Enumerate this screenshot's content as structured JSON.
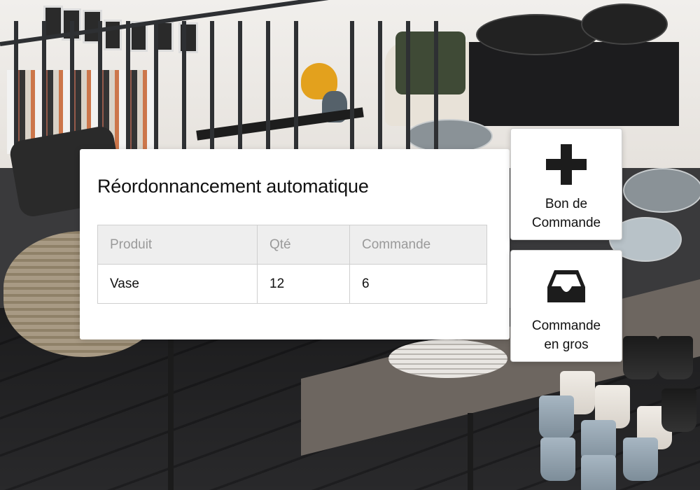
{
  "card": {
    "title": "Réordonnancement automatique",
    "table": {
      "headers": [
        "Produit",
        "Qté",
        "Commande"
      ],
      "rows": [
        [
          "Vase",
          "12",
          "6"
        ]
      ]
    }
  },
  "actions": [
    {
      "id": "purchase-order",
      "icon": "plus-icon",
      "label_lines": [
        "Bon de",
        "Commande"
      ]
    },
    {
      "id": "bulk-order",
      "icon": "inbox-tray-icon",
      "label_lines": [
        "Commande",
        "en gros"
      ]
    }
  ],
  "colors": {
    "card_bg": "#ffffff",
    "header_bg": "#eeeeee",
    "header_text": "#9a9a9a",
    "text": "#111111",
    "icon": "#1c1c1c"
  }
}
